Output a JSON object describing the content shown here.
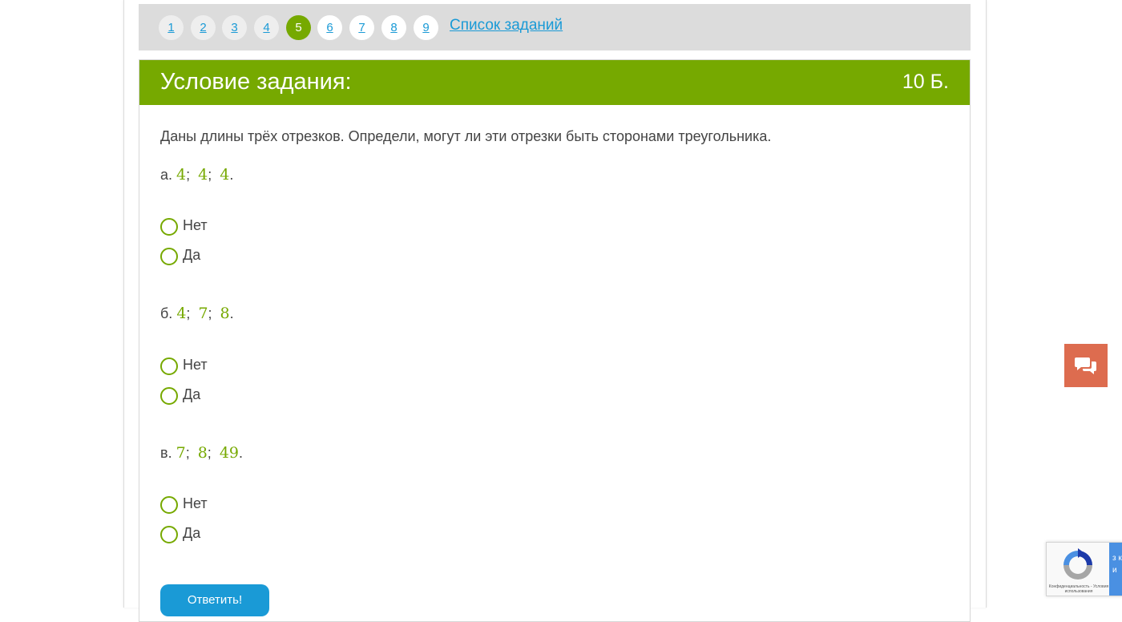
{
  "pager": {
    "pages": [
      {
        "label": "1",
        "state": "visited"
      },
      {
        "label": "2",
        "state": "visited"
      },
      {
        "label": "3",
        "state": "visited"
      },
      {
        "label": "4",
        "state": "visited"
      },
      {
        "label": "5",
        "state": "active"
      },
      {
        "label": "6",
        "state": "normal"
      },
      {
        "label": "7",
        "state": "normal"
      },
      {
        "label": "8",
        "state": "normal"
      },
      {
        "label": "9",
        "state": "normal"
      }
    ],
    "task_list_link": "Список заданий"
  },
  "task": {
    "header_title": "Условие задания:",
    "points": "10 Б.",
    "statement": "Даны длины трёх отрезков. Определи, могут ли эти отрезки быть сторонами треугольника.",
    "subquestions": [
      {
        "letter": "а.",
        "values": [
          "4",
          "4",
          "4"
        ],
        "options": [
          "Нет",
          "Да"
        ]
      },
      {
        "letter": "б.",
        "values": [
          "4",
          "7",
          "8"
        ],
        "options": [
          "Нет",
          "Да"
        ]
      },
      {
        "letter": "в.",
        "values": [
          "7",
          "8",
          "49"
        ],
        "options": [
          "Нет",
          "Да"
        ]
      }
    ],
    "submit_label": "Ответить!"
  },
  "recaptcha": {
    "legal_text": "Конфиденциальность - Условия использования",
    "panel_text": "з к и"
  },
  "colors": {
    "accent_green": "#76a900",
    "link_blue": "#1a9ad6",
    "chat_orange": "#dd6c4f"
  }
}
